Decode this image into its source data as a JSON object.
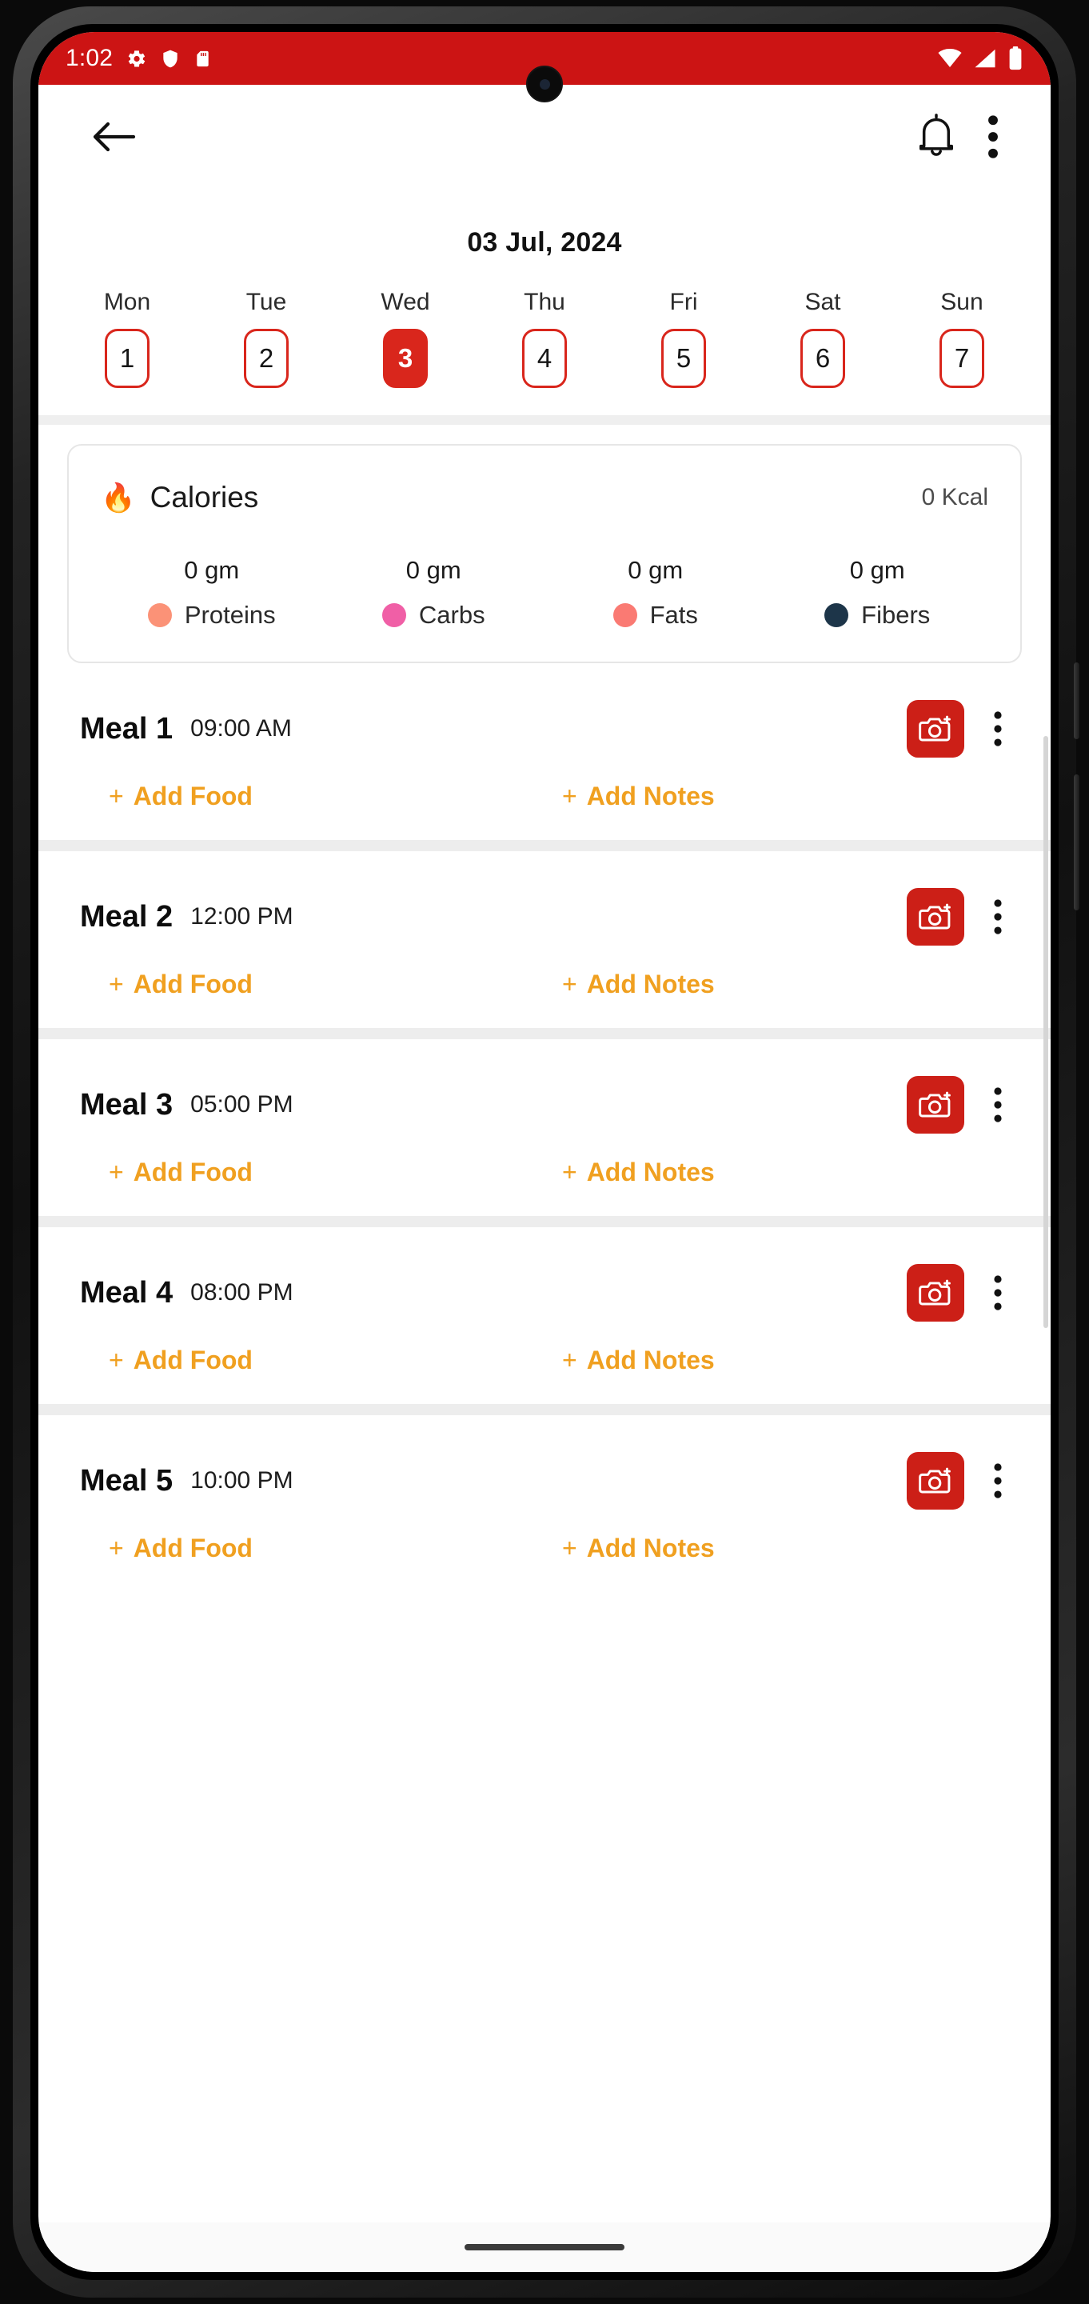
{
  "status_bar": {
    "time": "1:02",
    "left_icons": [
      "gear-icon",
      "shield-icon",
      "sd-card-icon"
    ],
    "right_icons": [
      "wifi-icon",
      "cellular-signal-icon",
      "battery-icon"
    ],
    "background_color": "#cc1414"
  },
  "app_bar": {
    "back_icon": "arrow-left-icon",
    "notification_icon": "bell-icon",
    "overflow_icon": "kebab-menu-icon"
  },
  "header": {
    "date_title": "03 Jul, 2024"
  },
  "week_strip": {
    "selected_index": 2,
    "accent_color": "#d9261c",
    "days": [
      {
        "name": "Mon",
        "number": "1"
      },
      {
        "name": "Tue",
        "number": "2"
      },
      {
        "name": "Wed",
        "number": "3"
      },
      {
        "name": "Thu",
        "number": "4"
      },
      {
        "name": "Fri",
        "number": "5"
      },
      {
        "name": "Sat",
        "number": "6"
      },
      {
        "name": "Sun",
        "number": "7"
      }
    ]
  },
  "calories_card": {
    "flame_icon": "🔥",
    "title": "Calories",
    "value": "0 Kcal",
    "macros": [
      {
        "value": "0 gm",
        "label": "Proteins",
        "color": "#fb9277"
      },
      {
        "value": "0 gm",
        "label": "Carbs",
        "color": "#f05fa6"
      },
      {
        "value": "0 gm",
        "label": "Fats",
        "color": "#fa7a73"
      },
      {
        "value": "0 gm",
        "label": "Fibers",
        "color": "#1d3549"
      }
    ]
  },
  "meals": {
    "add_food_label": "Add Food",
    "add_notes_label": "Add Notes",
    "plus_symbol": "+",
    "camera_icon": "camera-add-icon",
    "overflow_icon": "kebab-menu-icon",
    "link_color": "#f0a020",
    "camera_button_color": "#cc1f17",
    "items": [
      {
        "name": "Meal 1",
        "time": "09:00 AM"
      },
      {
        "name": "Meal 2",
        "time": "12:00 PM"
      },
      {
        "name": "Meal 3",
        "time": "05:00 PM"
      },
      {
        "name": "Meal 4",
        "time": "08:00 PM"
      },
      {
        "name": "Meal 5",
        "time": "10:00 PM"
      }
    ]
  }
}
